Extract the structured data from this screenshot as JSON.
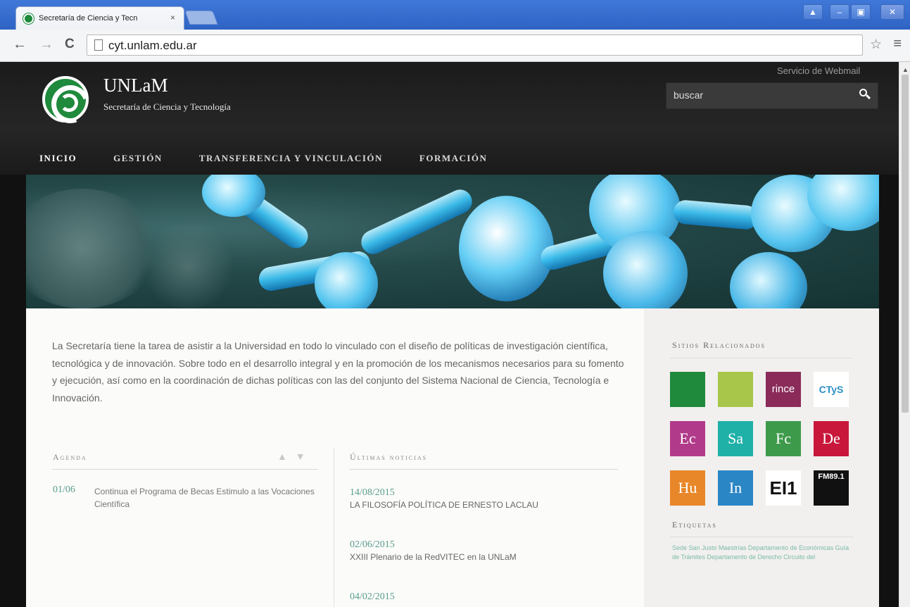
{
  "browser": {
    "tab_title": "Secretaría de Ciencia y Tecn",
    "tab_close": "×",
    "url": "cyt.unlam.edu.ar",
    "back": "←",
    "forward": "→",
    "reload": "C",
    "star": "☆",
    "menu": "≡",
    "window_buttons": [
      "▲",
      "–",
      "▣",
      "✕"
    ]
  },
  "header": {
    "site_name": "UNLaM",
    "subtitle": "Secretaría de Ciencia y Tecnología",
    "webmail_link": "Servicio de Webmail",
    "search_placeholder": "buscar"
  },
  "nav": {
    "items": [
      "INICIO",
      "GESTIÓN",
      "TRANSFERENCIA Y VINCULACIÓN",
      "FORMACIÓN"
    ]
  },
  "main": {
    "intro": "La Secretaría tiene la tarea de asistir a la Universidad en todo lo vinculado con el diseño de políticas de investigación científica, tecnológica y de innovación. Sobre todo en el desarrollo integral y en la promoción de los mecanismos necesarios para su fomento y ejecución, así como en la coordinación de dichas políticas con las del conjunto del Sistema Nacional de Ciencia, Tecnología e Innovación.",
    "agenda": {
      "title": "Agenda",
      "arrows": "▲ ▼",
      "items": [
        {
          "date": "01/06",
          "text": "Continua el Programa de Becas Estimulo a las Vocaciones Científica"
        }
      ]
    },
    "news": {
      "title": "Últimas noticias",
      "items": [
        {
          "date": "14/08/2015",
          "headline": "LA FILOSOFÍA POLÍTICA DE ERNESTO LACLAU"
        },
        {
          "date": "02/06/2015",
          "headline": "XXIII Plenario de la RedVITEC en la UNLaM"
        },
        {
          "date": "04/02/2015",
          "headline": ""
        }
      ]
    }
  },
  "sidebar": {
    "related_title": "Sitios Relacionados",
    "tiles": [
      {
        "label": "",
        "color": "#1f8a3c"
      },
      {
        "label": "",
        "color": "#a8c64a"
      },
      {
        "label": "rince",
        "color": "#8a2b5a"
      },
      {
        "label": "CTyS",
        "color": "#ffffff"
      },
      {
        "label": "Ec",
        "color": "#b23a8a"
      },
      {
        "label": "Sa",
        "color": "#1fb0a8"
      },
      {
        "label": "Fc",
        "color": "#3e9a4b"
      },
      {
        "label": "De",
        "color": "#c8173b"
      },
      {
        "label": "Hu",
        "color": "#e8872a"
      },
      {
        "label": "In",
        "color": "#2a86c4"
      },
      {
        "label": "EI1",
        "color": "#ffffff"
      },
      {
        "label": "FM89.1",
        "color": "#111111"
      }
    ],
    "tags_title": "Etiquetas",
    "tags_text": "Sede San Justo Maestrías Departamento de Económicas Guía de Trámites Departamento de Derecho Circuito del"
  },
  "colors": {
    "accent": "#5a9d8e",
    "header_bg": "#1f1f1f",
    "browser_blue": "#3a70d2"
  }
}
